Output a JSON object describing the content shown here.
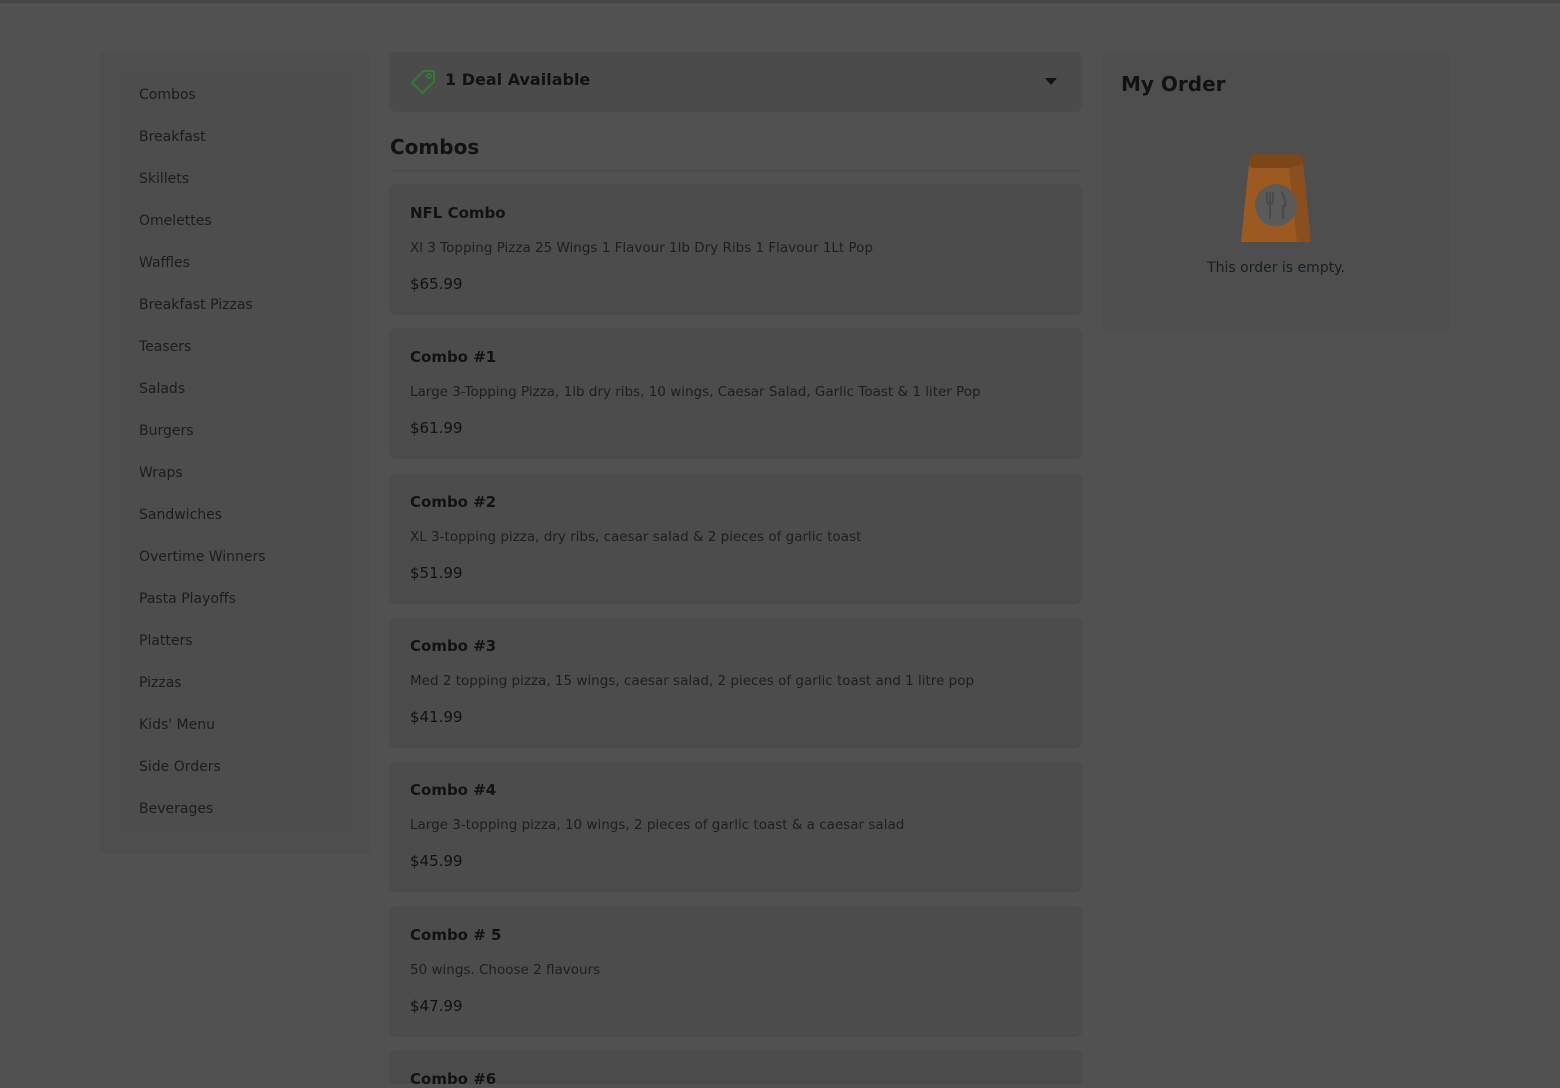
{
  "categories": [
    "Combos",
    "Breakfast",
    "Skillets",
    "Omelettes",
    "Waffles",
    "Breakfast Pizzas",
    "Teasers",
    "Salads",
    "Burgers",
    "Wraps",
    "Sandwiches",
    "Overtime Winners",
    "Pasta Playoffs",
    "Platters",
    "Pizzas",
    "Kids' Menu",
    "Side Orders",
    "Beverages"
  ],
  "deals": {
    "label": "1 Deal Available",
    "icon": "tag-icon"
  },
  "section": {
    "title": "Combos"
  },
  "items": [
    {
      "name": "NFL Combo",
      "description": "Xl 3 Topping Pizza 25 Wings 1 Flavour 1lb Dry Ribs 1 Flavour 1Lt Pop",
      "price": "$65.99"
    },
    {
      "name": "Combo #1",
      "description": "Large 3-Topping Pizza, 1lb dry ribs, 10 wings, Caesar Salad, Garlic Toast & 1 liter Pop",
      "price": "$61.99"
    },
    {
      "name": "Combo #2",
      "description": "XL 3-topping pizza, dry ribs, caesar salad & 2 pieces of garlic toast",
      "price": "$51.99"
    },
    {
      "name": "Combo #3",
      "description": "Med 2 topping pizza, 15 wings, caesar salad, 2 pieces of garlic toast and 1 litre pop",
      "price": "$41.99"
    },
    {
      "name": "Combo #4",
      "description": "Large 3-topping pizza, 10 wings, 2 pieces of garlic toast & a caesar salad",
      "price": "$45.99"
    },
    {
      "name": "Combo # 5",
      "description": "50 wings. Choose 2 flavours",
      "price": "$47.99"
    },
    {
      "name": "Combo #6",
      "description": "",
      "price": ""
    }
  ],
  "order": {
    "title": "My Order",
    "empty_message": "This order is empty.",
    "icon": "bag-icon"
  },
  "colors": {
    "bag": "#b5651d",
    "deal_tag": "#2e7d32"
  }
}
